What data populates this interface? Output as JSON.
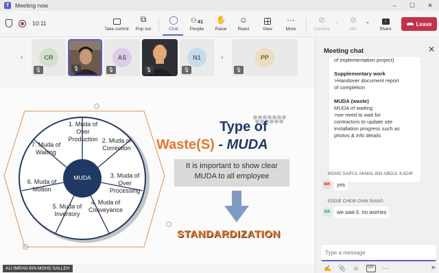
{
  "window": {
    "title": "Meeting now",
    "controls": [
      "–",
      "☐",
      "✕"
    ]
  },
  "toolbar": {
    "timer": "10:11",
    "buttons": [
      {
        "id": "take-control",
        "label": "Take control",
        "icon": "hand-pointer-icon",
        "glyph": "⊡",
        "state": "normal"
      },
      {
        "id": "pop-out",
        "label": "Pop out",
        "icon": "pop-out-icon",
        "glyph": "⧉",
        "state": "normal"
      },
      {
        "id": "chat",
        "label": "Chat",
        "icon": "chat-icon",
        "glyph": "💬",
        "state": "active"
      },
      {
        "id": "people",
        "label": "People",
        "icon": "people-icon",
        "glyph": "👥",
        "count": "41",
        "state": "normal"
      },
      {
        "id": "raise",
        "label": "Raise",
        "icon": "raise-hand-icon",
        "glyph": "✋",
        "state": "normal"
      },
      {
        "id": "react",
        "label": "React",
        "icon": "smile-icon",
        "glyph": "☺",
        "state": "normal"
      },
      {
        "id": "view",
        "label": "View",
        "icon": "grid-view-icon",
        "glyph": "",
        "state": "normal"
      },
      {
        "id": "more",
        "label": "More",
        "icon": "more-icon",
        "glyph": "···",
        "state": "normal"
      },
      {
        "id": "camera",
        "label": "Camera",
        "icon": "camera-off-icon",
        "glyph": "◫",
        "state": "disabled"
      },
      {
        "id": "mic",
        "label": "Mic",
        "icon": "mic-off-icon",
        "glyph": "🎙",
        "state": "disabled"
      },
      {
        "id": "share",
        "label": "Share",
        "icon": "share-icon",
        "glyph": "⇪",
        "state": "normal"
      }
    ],
    "leave_label": "Leave"
  },
  "participants": [
    {
      "initials": "CR",
      "bg": "#e8ece3",
      "fg": "#5b6b4f",
      "avatar_bg": "#d6dfcd",
      "muted": true
    },
    {
      "initials": "",
      "kind": "video-person",
      "muted": true,
      "selected": true
    },
    {
      "initials": "AS",
      "bg": "#ece6ef",
      "fg": "#6b5a78",
      "avatar_bg": "#dccde6",
      "muted": true
    },
    {
      "initials": "",
      "kind": "video-avatar",
      "muted": true
    },
    {
      "initials": "N1",
      "bg": "#e2eaf0",
      "fg": "#4d6a80",
      "avatar_bg": "#c9dbe8",
      "muted": true
    },
    {
      "initials": "PP",
      "bg": "#efe9df",
      "fg": "#7a6540",
      "avatar_bg": "#ecdcc0",
      "muted": true
    }
  ],
  "slide": {
    "center_label": "MUDA",
    "segments": [
      "1. Muda of Over Production",
      "2. Muda of Correction",
      "3. Muda of Over Processing",
      "4. Muda of Conveyance",
      "5. Muda of Inventory",
      "6. Muda of Motion",
      "7. Muda of Waiting"
    ],
    "heading_line1": "Type of",
    "heading_part_a": "Waste(S)",
    "heading_part_b": " - MUDA",
    "note": "It is important to show clear MUDA to all employee",
    "keyword": "STANDARDIZATION",
    "colors": {
      "navy": "#1f3864",
      "orange": "#e8762c",
      "gray_box": "#d9d9d9",
      "arrow": "#7f9cc4"
    }
  },
  "presenter_name": "ALI IMRAN BIN MOHD SALLEH",
  "chat": {
    "title": "Meeting chat",
    "pinned_lines": [
      {
        "text": "of implementation project)",
        "bold": false
      },
      {
        "text": "",
        "bold": false
      },
      {
        "text": "Supplementary work",
        "bold": true
      },
      {
        "text": ">Handover document report",
        "bold": false
      },
      {
        "text": "of completion",
        "bold": false
      },
      {
        "text": "",
        "bold": false
      },
      {
        "text": "MUDA (waste)",
        "bold": true
      },
      {
        "text": "MUDA of waiting",
        "bold": false
      },
      {
        "text": ">we need to wait for",
        "bold": false
      },
      {
        "text": "contractors to update site",
        "bold": false
      },
      {
        "text": "installation progress such as",
        "bold": false
      },
      {
        "text": "photos & info details",
        "bold": false
      }
    ],
    "messages": [
      {
        "sender": "MOHD SAIFUL AKMAL BIN ABDUL KADIR",
        "initials": "MK",
        "avatar_bg": "#f3d9d6",
        "avatar_fg": "#a4373a",
        "text": "yes"
      },
      {
        "sender": "EDDIE CHEW CHIN SIANG",
        "initials": "ES",
        "avatar_bg": "#d4ece4",
        "avatar_fg": "#2b7a5f",
        "text": "we saw it. no worries"
      }
    ],
    "compose_placeholder": "Type a message",
    "compose_tools": [
      "✍",
      "📎",
      "☺",
      "GIF",
      "⋯"
    ]
  }
}
